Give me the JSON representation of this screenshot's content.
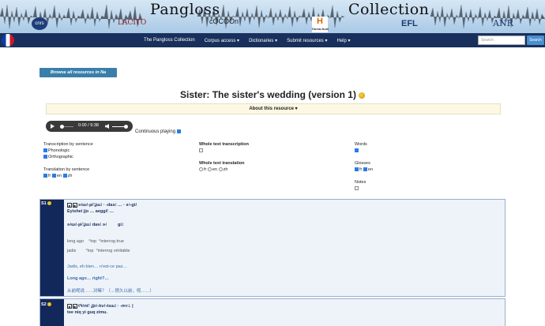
{
  "banner": {
    "title_left": "Pangloss",
    "title_right": "Collection",
    "logos": {
      "cnrs": "cnrs",
      "lacito": "LACITO",
      "cocoon": "cOCOOn",
      "huma": "H",
      "huma_sub": "Huma-Num",
      "efl": "EFL",
      "anr": "ANR"
    }
  },
  "nav": {
    "items": [
      {
        "label": "The Pangloss Collection"
      },
      {
        "label": "Corpus access ▾"
      },
      {
        "label": "Dictionaries ▾"
      },
      {
        "label": "Submit resources ▾"
      },
      {
        "label": "Help ▾"
      }
    ],
    "search_placeholder": "Search",
    "search_button": "Search"
  },
  "browse_button": "Browse all resources in Na",
  "resource": {
    "title": "Sister: The sister's wedding (version 1)",
    "about": "About this resource ▾"
  },
  "player": {
    "time": "0:00 / 9:38",
    "continuous": "Continuous playing"
  },
  "options": {
    "transcription_by_sentence": "Transcription by sentence",
    "phonologic": "Phonologic",
    "orthographic": "Orthographic",
    "translation_by_sentence": "Translation by sentence",
    "trans_fr": "fr",
    "trans_en": "en",
    "trans_zh": "zh",
    "whole_text_transcription": "Whole text transcription",
    "whole_text_translation": "Whole text translation",
    "wt_fr": "fr",
    "wt_en": "en",
    "wt_zh": "zh",
    "words": "Words",
    "glosses": "Glosses",
    "gl_fr": "fr",
    "gl_en": "en",
    "notes": "Notes"
  },
  "sentences": [
    {
      "num": "S1",
      "phon": "ə˧ɯ˩˥-ʂɨ˥ʝɯ˩ · -daə˩ … · ə˧-gi˩˥",
      "orth": "Eyishei jjo … aeggi! …",
      "word_phon": "ə˧ɯ˩˥-ʂɨ˥ʝɯ˩ daə˩ ə˧",
      "word_phon2": "gi˩",
      "gloss_en": "long ago    °top  °interrog true",
      "gloss_fr": "jadis        °top  °interrog véritable",
      "tr_fr": "Jadis, eh bien… n'est-ce pas…",
      "tr_en": "Long ago… right?…",
      "tr_zh": "从前呢说……对嘛？（→很久以前，呃……）"
    },
    {
      "num": "S2",
      "phon": "tʰɨ˩˥nɨ˥ ʝjɪ˧-kv˩˥-tsɯ˩ · -mʏ˩. |",
      "orth": "tee niq yi guq zimu."
    }
  ]
}
